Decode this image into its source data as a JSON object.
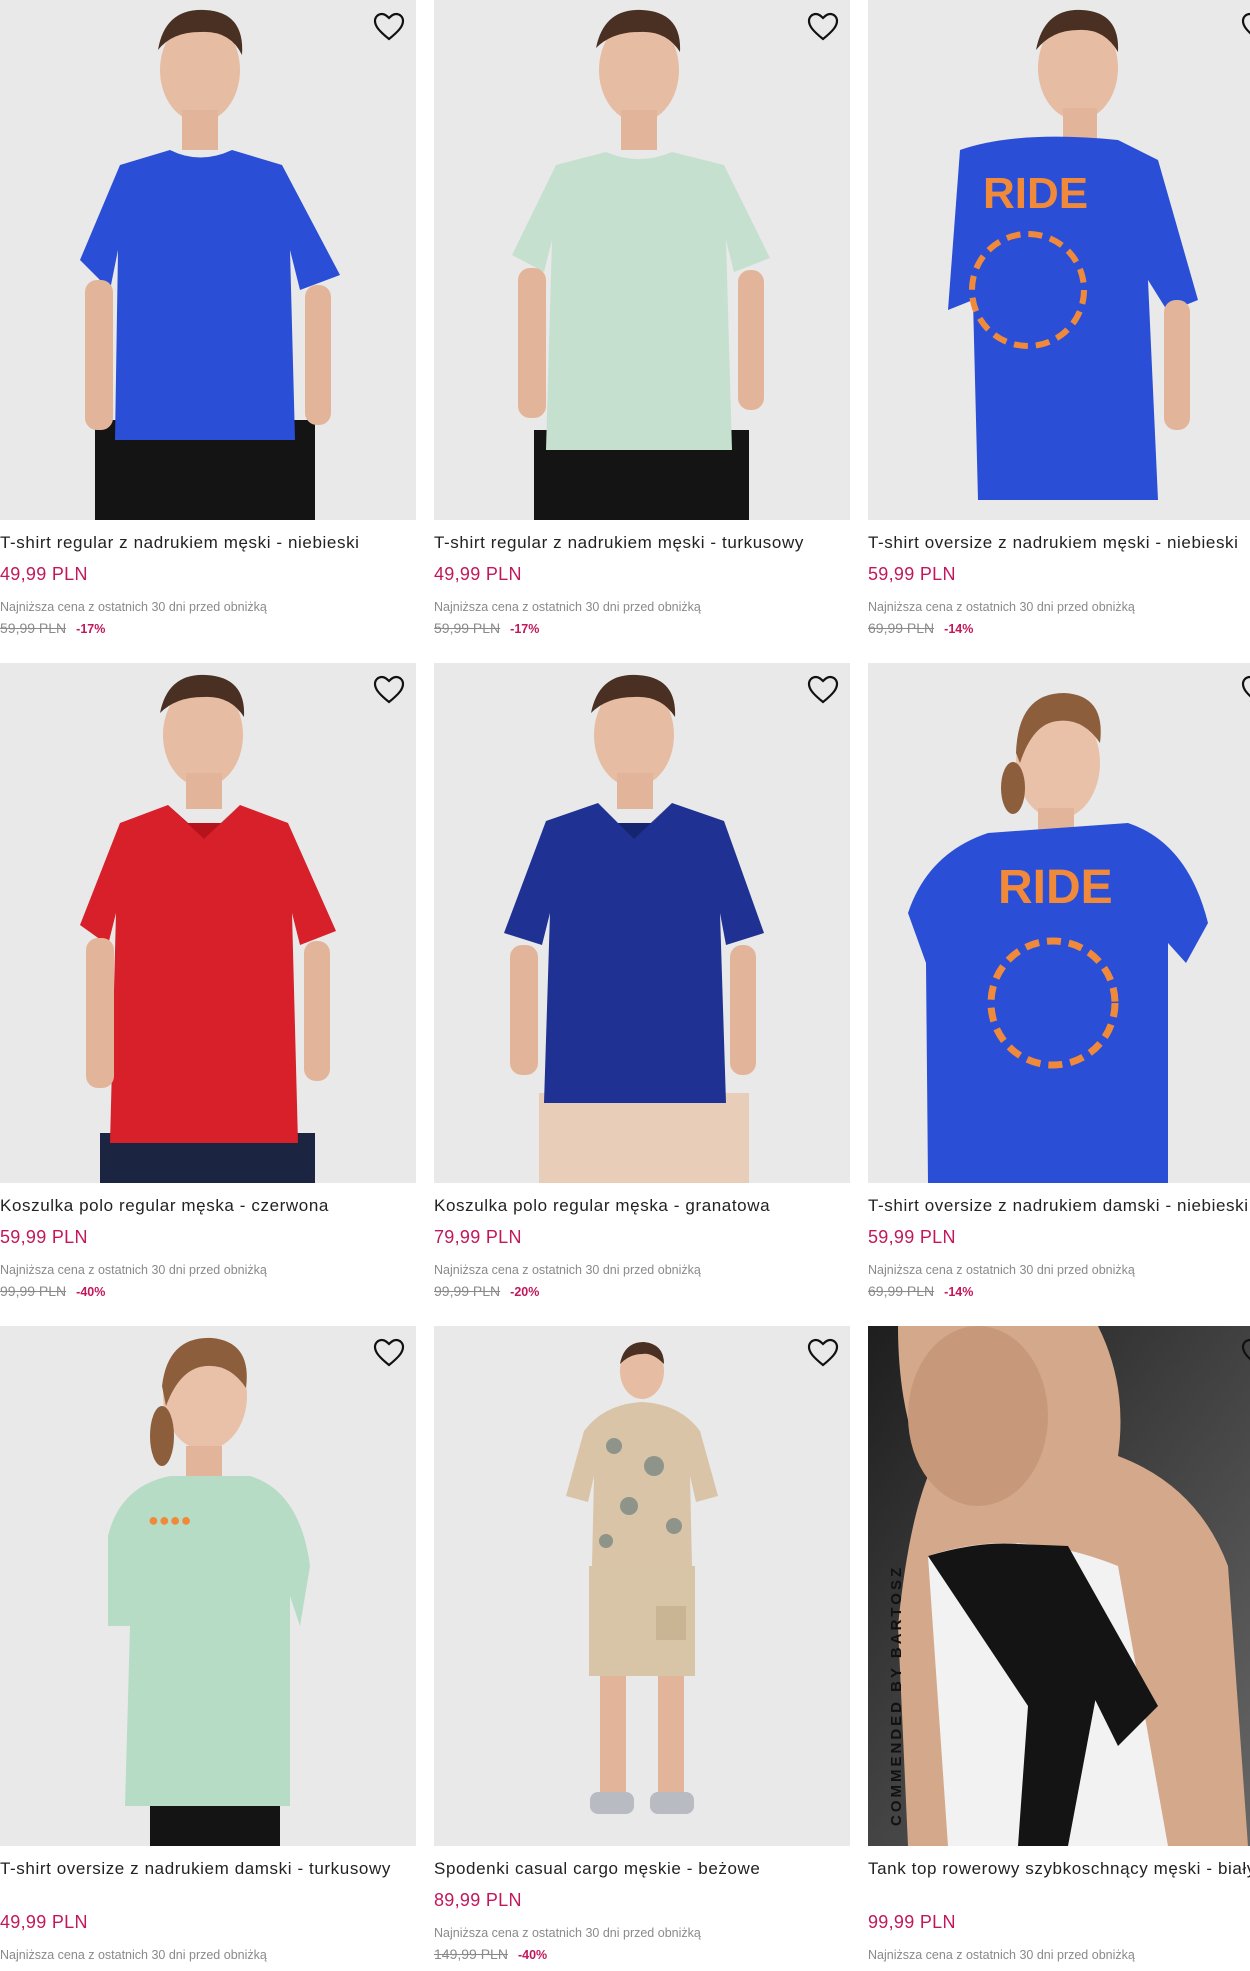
{
  "wishlist_icon": "heart-outline-icon",
  "colors": {
    "price": "#c2185b",
    "discount": "#c2185b",
    "muted": "#8a8a8a",
    "image_bg": "#e9e9e9"
  },
  "products": [
    {
      "title": "T-shirt regular z nadrukiem męski - niebieski",
      "price": "49,99 PLN",
      "lowest_label": "Najniższa cena z ostatnich 30 dni przed obniżką",
      "old_price": "59,99 PLN",
      "discount": "-17%",
      "garment_color": "#2a4fd6"
    },
    {
      "title": "T-shirt regular z nadrukiem męski - turkusowy",
      "price": "49,99 PLN",
      "lowest_label": "Najniższa cena z ostatnich 30 dni przed obniżką",
      "old_price": "59,99 PLN",
      "discount": "-17%",
      "garment_color": "#c6e0cf"
    },
    {
      "title": "T-shirt oversize z nadrukiem męski - niebieski",
      "price": "59,99 PLN",
      "lowest_label": "Najniższa cena z ostatnich 30 dni przed obniżką",
      "old_price": "69,99 PLN",
      "discount": "-14%",
      "garment_color": "#2a4fd6",
      "print_text": "RIDE"
    },
    {
      "title": "Koszulka polo regular męska - czerwona",
      "price": "59,99 PLN",
      "lowest_label": "Najniższa cena z ostatnich 30 dni przed obniżką",
      "old_price": "99,99 PLN",
      "discount": "-40%",
      "garment_color": "#d8202a"
    },
    {
      "title": "Koszulka polo regular męska - granatowa",
      "price": "79,99 PLN",
      "lowest_label": "Najniższa cena z ostatnich 30 dni przed obniżką",
      "old_price": "99,99 PLN",
      "discount": "-20%",
      "garment_color": "#1f3293"
    },
    {
      "title": "T-shirt oversize z nadrukiem damski - niebieski",
      "price": "59,99 PLN",
      "lowest_label": "Najniższa cena z ostatnich 30 dni przed obniżką",
      "old_price": "69,99 PLN",
      "discount": "-14%",
      "garment_color": "#2a4fd6",
      "print_text": "RIDE"
    },
    {
      "title": "T-shirt oversize z nadrukiem damski - turkusowy",
      "price": "49,99 PLN",
      "lowest_label": "Najniższa cena z ostatnich 30 dni przed obniżką",
      "garment_color": "#b7dcc6"
    },
    {
      "title": "Spodenki casual cargo męskie - beżowe",
      "price": "89,99 PLN",
      "lowest_label": "Najniższa cena z ostatnich 30 dni przed obniżką",
      "old_price": "149,99 PLN",
      "discount": "-40%",
      "garment_color": "#d9c4a8"
    },
    {
      "title": "Tank top rowerowy szybkoschnący męski - biały",
      "price": "99,99 PLN",
      "lowest_label": "Najniższa cena z ostatnich 30 dni przed obniżką",
      "garment_color": "#f2f2f2",
      "badge_text": "COMMENDED BY BARTOSZ"
    }
  ]
}
